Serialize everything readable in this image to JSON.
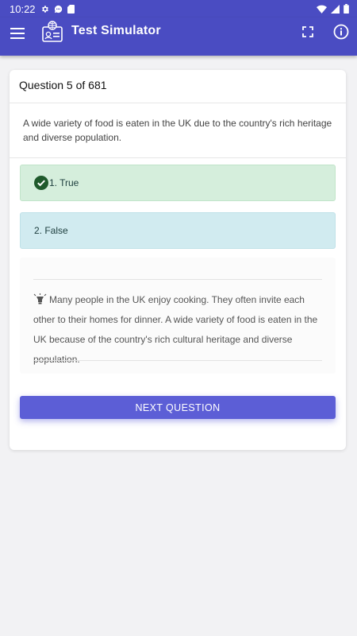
{
  "status_bar": {
    "time": "10:22",
    "icons": [
      "gear-icon",
      "chat-bubble-icon",
      "sd-card-icon",
      "wifi-icon",
      "cell-signal-icon",
      "battery-icon"
    ]
  },
  "app_bar": {
    "title": "Test Simulator",
    "menu_icon": "menu-icon",
    "logo_icon": "id-card-globe-icon",
    "fullscreen_icon": "fullscreen-icon",
    "info_icon": "info-icon"
  },
  "question": {
    "header": "Question 5 of 681",
    "text": "A wide variety of food is eaten in the UK due to the country's rich heritage and diverse population."
  },
  "answers": [
    {
      "label": "1. True",
      "state": "correct",
      "icon": "check-circle-icon"
    },
    {
      "label": "2. False",
      "state": "neutral"
    }
  ],
  "explanation": {
    "icon": "light-bulb-icon",
    "text": "Many people in the UK enjoy cooking. They often invite each other to their homes for dinner. A wide variety of food is eaten in the UK because of the country's rich cultural heritage and diverse population."
  },
  "next_button": {
    "label": "NEXT QUESTION"
  },
  "colors": {
    "primary": "#4a4cc2",
    "button": "#5c5ed6",
    "correct_bg": "#d5eedc",
    "neutral_bg": "#d1ebf0",
    "check": "#1f5a2c"
  }
}
